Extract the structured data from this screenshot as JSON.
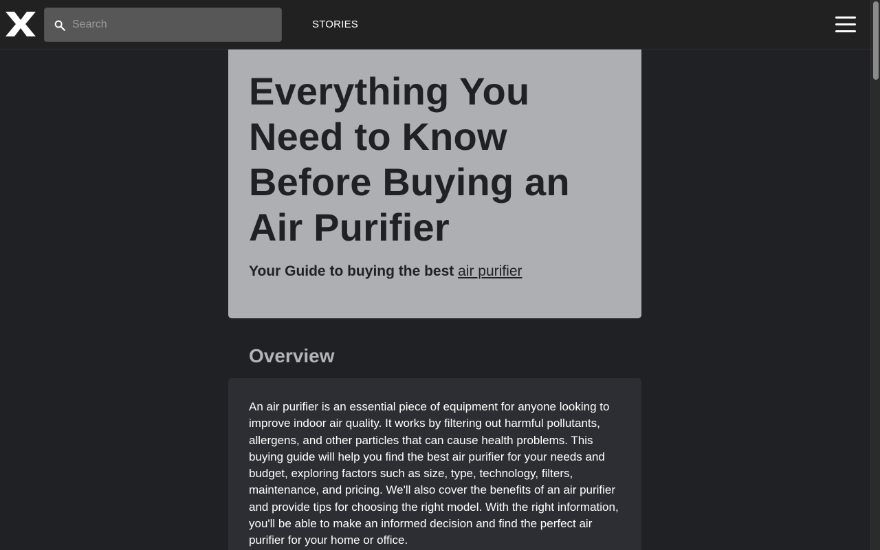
{
  "header": {
    "logo_alt": "X",
    "search": {
      "placeholder": "Search",
      "value": ""
    },
    "nav": {
      "stories": "STORIES"
    },
    "menu_icon": "hamburger-menu-icon"
  },
  "hero": {
    "title": "Everything You Need to Know Before Buying an Air Purifier",
    "subtitle_prefix": "Your Guide to buying the best ",
    "subtitle_link": "air purifier"
  },
  "overview": {
    "heading": "Overview",
    "body": "An air purifier is an essential piece of equipment for anyone looking to improve indoor air quality. It works by filtering out harmful pollutants, allergens, and other particles that can cause health problems. This buying guide will help you find the best air purifier for your needs and budget, exploring factors such as size, type, technology, filters, maintenance, and pricing. We'll also cover the benefits of an air purifier and provide tips for choosing the right model. With the right information, you'll be able to make an informed decision and find the perfect air purifier for your home or office."
  },
  "colors": {
    "page_background": "#202125",
    "header_background": "#212121",
    "hero_background": "#aeafb2",
    "card_background": "#2d2e33",
    "text_dark": "#202125",
    "text_light": "#ffffff",
    "heading_muted": "#b4b4b6"
  }
}
